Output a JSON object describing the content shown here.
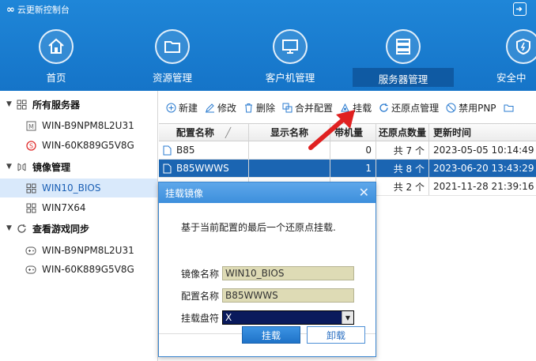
{
  "app": {
    "title": "云更新控制台",
    "logo": "∞"
  },
  "nav": [
    {
      "label": "首页"
    },
    {
      "label": "资源管理"
    },
    {
      "label": "客户机管理"
    },
    {
      "label": "服务器管理"
    },
    {
      "label": "安全中"
    }
  ],
  "sidebar": {
    "groups": [
      {
        "label": "所有服务器",
        "items": [
          "WIN-B9NPM8L2U31",
          "WIN-60K889G5V8G"
        ]
      },
      {
        "label": "镜像管理",
        "items": [
          "WIN10_BIOS",
          "WIN7X64"
        ]
      },
      {
        "label": "查看游戏同步",
        "items": [
          "WIN-B9NPM8L2U31",
          "WIN-60K889G5V8G"
        ]
      }
    ]
  },
  "toolbar": {
    "new": "新建",
    "edit": "修改",
    "delete": "删除",
    "merge": "合并配置",
    "mount": "挂载",
    "restore": "还原点管理",
    "disable_pnp": "禁用PNP"
  },
  "table": {
    "headers": [
      "配置名称",
      "显示名称",
      "带机量",
      "还原点数量",
      "更新时间"
    ],
    "sort_glyph": "╱",
    "rows": [
      {
        "name": "B85",
        "display": "",
        "count": "0",
        "restore": "共 7 个",
        "time": "2023-05-05 10:14:49"
      },
      {
        "name": "B85WWWS",
        "display": "",
        "count": "1",
        "restore": "共 8 个",
        "time": "2023-06-20 13:43:29"
      },
      {
        "name": "",
        "display": "",
        "count": "",
        "restore": "共 2 个",
        "time": "2021-11-28 21:39:16"
      }
    ]
  },
  "dialog": {
    "title": "挂载镜像",
    "message": "基于当前配置的最后一个还原点挂载.",
    "image_label": "镜像名称",
    "image_value": "WIN10_BIOS",
    "config_label": "配置名称",
    "config_value": "B85WWWS",
    "drive_label": "挂载盘符",
    "drive_value": "X",
    "mount_button": "挂载",
    "unmount_button": "卸载"
  },
  "colors": {
    "header": "#1a7ed2",
    "selected_row": "#1b65b2",
    "arrow": "#e02020"
  }
}
